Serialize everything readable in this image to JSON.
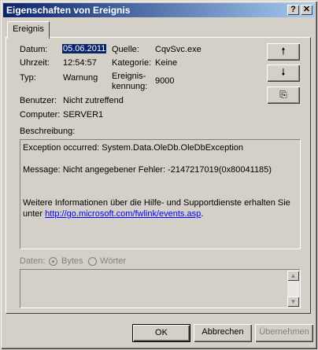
{
  "window": {
    "title": "Eigenschaften von Ereignis",
    "help_glyph": "?",
    "close_glyph": "✕"
  },
  "tab": {
    "label": "Ereignis"
  },
  "fields": {
    "date_label": "Datum:",
    "date_value": "05.06.2011",
    "time_label": "Uhrzeit:",
    "time_value": "12:54:57",
    "type_label": "Typ:",
    "type_value": "Warnung",
    "user_label": "Benutzer:",
    "user_value": "Nicht zutreffend",
    "computer_label": "Computer:",
    "computer_value": "SERVER1",
    "source_label": "Quelle:",
    "source_value": "CqvSvc.exe",
    "category_label": "Kategorie:",
    "category_value": "Keine",
    "eventid_label_1": "Ereignis-",
    "eventid_label_2": "kennung:",
    "eventid_value": "9000"
  },
  "nav": {
    "up_glyph": "🠕",
    "down_glyph": "🠗",
    "copy_glyph": "⎘"
  },
  "description": {
    "label": "Beschreibung:",
    "line1": "Exception occurred:  System.Data.OleDb.OleDbException",
    "line2": "Message:  Nicht angegebener Fehler: -2147217019(0x80041185)",
    "line3": "Weitere Informationen über die Hilfe- und Supportdienste erhalten Sie",
    "line4_prefix": "unter ",
    "link": "http://go.microsoft.com/fwlink/events.asp",
    "line4_suffix": "."
  },
  "data": {
    "label": "Daten:",
    "bytes_label": "Bytes",
    "words_label": "Wörter",
    "selected": "Bytes"
  },
  "buttons": {
    "ok": "OK",
    "cancel": "Abbrechen",
    "apply": "Übernehmen"
  }
}
